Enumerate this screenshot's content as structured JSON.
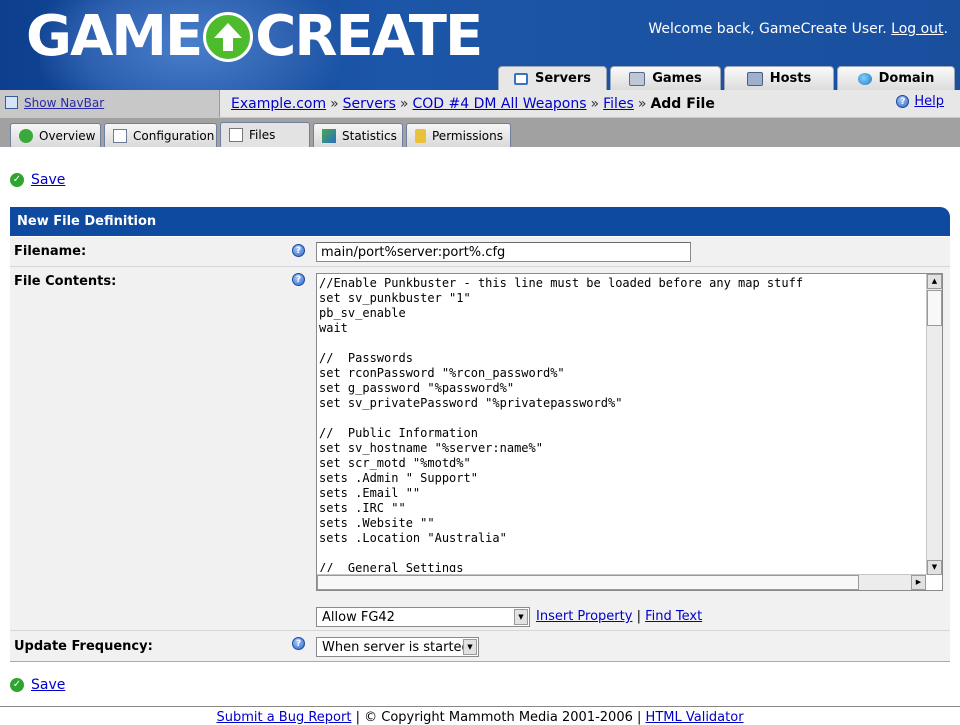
{
  "header": {
    "logo_left": "GAME",
    "logo_right": "CREATE",
    "welcome_text": "Welcome back, GameCreate User.",
    "logout_label": "Log out",
    "logout_suffix": "."
  },
  "main_tabs": [
    {
      "label": "Servers",
      "icon": "servers-icon"
    },
    {
      "label": "Games",
      "icon": "joystick-icon"
    },
    {
      "label": "Hosts",
      "icon": "hosts-icon"
    },
    {
      "label": "Domain",
      "icon": "globe-icon"
    }
  ],
  "navbar_toggle": {
    "label": "Show NavBar"
  },
  "breadcrumb": {
    "items": [
      "Example.com",
      "Servers",
      "COD #4 DM All Weapons",
      "Files"
    ],
    "separator": "»",
    "current": "Add File"
  },
  "help_label": "Help",
  "sub_tabs": [
    {
      "label": "Overview",
      "icon": "up-arrow-icon"
    },
    {
      "label": "Configuration",
      "icon": "edit-icon"
    },
    {
      "label": "Files",
      "icon": "files-icon"
    },
    {
      "label": "Statistics",
      "icon": "chart-icon"
    },
    {
      "label": "Permissions",
      "icon": "lock-icon"
    }
  ],
  "save_label": "Save",
  "form": {
    "title": "New File Definition",
    "filename_label": "Filename:",
    "filename_value": "main/port%server:port%.cfg",
    "contents_label": "File Contents:",
    "contents_lines": [
      "//Enable Punkbuster - this line must be loaded before any map stuff",
      "set sv_punkbuster \"1\"",
      "pb_sv_enable",
      "wait",
      "",
      "//  Passwords",
      "set rconPassword \"%rcon_password%\"",
      "set g_password \"%password%\"",
      "set sv_privatePassword \"%privatepassword%\"",
      "",
      "//  Public Information",
      "set sv_hostname \"%server:name%\"",
      "set scr_motd \"%motd%\"",
      "sets .Admin \" Support\"",
      "sets .Email \"\"",
      "sets .IRC \"\"",
      "sets .Website \"\"",
      "sets .Location \"Australia\"",
      "",
      "//  General Settings"
    ],
    "property_select": "Allow FG42",
    "insert_property_label": "Insert Property",
    "find_text_label": "Find Text",
    "link_separator": "|",
    "update_label": "Update Frequency:",
    "update_select": "When server is started"
  },
  "footer": {
    "bug_report": "Submit a Bug Report",
    "copyright": "© Copyright Mammoth Media 2001-2006",
    "validator": "HTML Validator",
    "separator": "|"
  },
  "colors": {
    "header_blue": "#1c56a8",
    "form_header": "#0d4aa0",
    "logo_green": "#4dbb2c",
    "link": "#0000cc"
  }
}
